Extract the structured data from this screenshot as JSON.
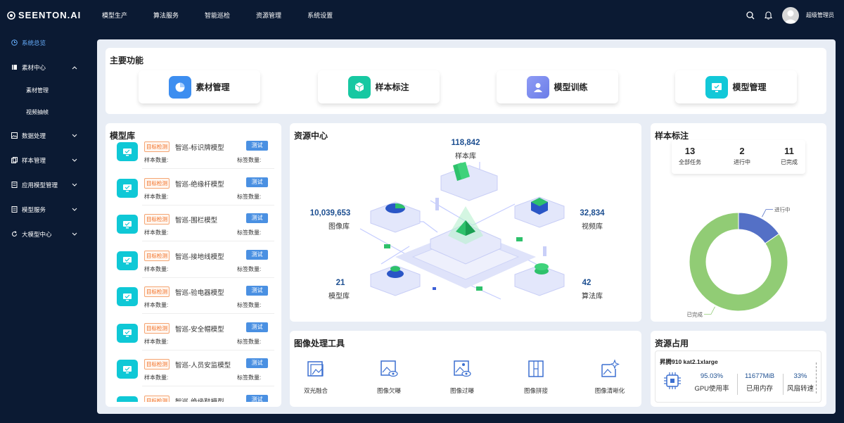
{
  "app": {
    "logo_text": "SEENTON.AI"
  },
  "topnav": {
    "items": [
      "模型生产",
      "算法服务",
      "智能巡检",
      "资源管理",
      "系统设置"
    ]
  },
  "user": {
    "name": "超级管理员"
  },
  "sidebar": {
    "overview": "系统总览",
    "material_center": "素材中心",
    "material_sub": [
      "素材管理",
      "视频抽帧"
    ],
    "groups": [
      "数据处理",
      "样本管理",
      "应用模型管理",
      "模型服务",
      "大模型中心"
    ]
  },
  "main_functions": {
    "title": "主要功能",
    "items": [
      {
        "label": "素材管理",
        "color": "#3d8ef0"
      },
      {
        "label": "样本标注",
        "color": "#17c8a2"
      },
      {
        "label": "模型训练",
        "color": "#7f8cf0"
      },
      {
        "label": "模型管理",
        "color": "#12c8d8"
      }
    ]
  },
  "model_library": {
    "title": "模型库",
    "badge": "目标检测",
    "test_label": "测试",
    "sample_count_label": "样本数量:",
    "tag_count_label": "标签数量:",
    "models": [
      "智巡-标识牌模型",
      "智巡-绝缘杆模型",
      "智巡-围栏模型",
      "智巡-接地线模型",
      "智巡-验电器模型",
      "智巡-安全帽模型",
      "智巡-人员安监模型",
      "智巡-绝缘鞋模型"
    ]
  },
  "resource_center": {
    "title": "资源中心",
    "sample": {
      "value": "118,842",
      "label": "样本库"
    },
    "image": {
      "value": "10,039,653",
      "label": "图像库"
    },
    "video": {
      "value": "32,834",
      "label": "视频库"
    },
    "model": {
      "value": "21",
      "label": "模型库"
    },
    "algorithm": {
      "value": "42",
      "label": "算法库"
    }
  },
  "sample_annotation": {
    "title": "样本标注",
    "stats": [
      {
        "value": "13",
        "label": "全部任务"
      },
      {
        "value": "2",
        "label": "进行中"
      },
      {
        "value": "11",
        "label": "已完成"
      }
    ],
    "chart_data": {
      "type": "pie",
      "categories": [
        "进行中",
        "已完成"
      ],
      "values": [
        2,
        11
      ],
      "colors": [
        "#5470c6",
        "#91cc75"
      ]
    }
  },
  "image_tools": {
    "title": "图像处理工具",
    "items": [
      "双光融合",
      "图像欠曝",
      "图像过曝",
      "图像拼接",
      "图像清晰化"
    ]
  },
  "resource_usage": {
    "title": "资源占用",
    "device": "昇腾910 kat2.1xlarge",
    "gpu": {
      "value": "95.03%",
      "label": "GPU使用率"
    },
    "mem": {
      "value": "11677MiB",
      "label": "已用内存"
    },
    "fan": {
      "value": "33%",
      "label": "风扇转速"
    }
  }
}
